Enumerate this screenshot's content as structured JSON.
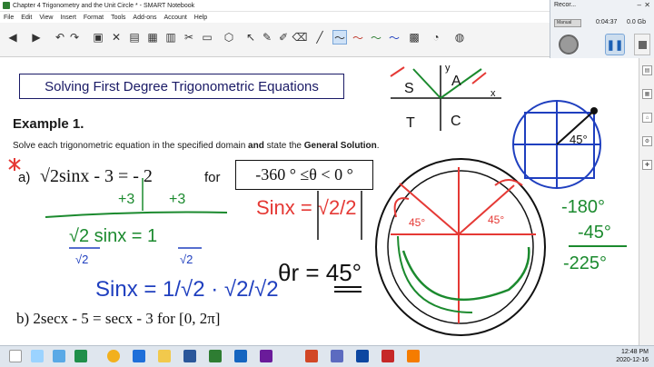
{
  "window": {
    "title": "Chapter 4 Trigonometry and the Unit Circle * - SMART Notebook"
  },
  "menu": [
    "File",
    "Edit",
    "View",
    "Insert",
    "Format",
    "Tools",
    "Add-ons",
    "Account",
    "Help"
  ],
  "toolbar": {
    "page_zoom_label": "Recor...",
    "icons": [
      "back-icon",
      "forward-icon",
      "add-page-icon",
      "delete-page-icon",
      "undo-icon",
      "redo-icon",
      "select-icon",
      "pen-icon",
      "eraser-icon",
      "line-icon",
      "shape-icon",
      "fill-icon",
      "text-icon",
      "table-icon",
      "camera-icon",
      "screen-shade-icon"
    ]
  },
  "recorder": {
    "title": "Recor...",
    "mode_label": "Manual",
    "elapsed": "0:04:37",
    "size": "0.0 Gb"
  },
  "lesson": {
    "title": "Solving First Degree Trigonometric Equations",
    "example_heading": "Example 1.",
    "instructions_prefix": "Solve each trigonometric equation in the specified domain ",
    "instructions_and": "and",
    "instructions_mid": " state the ",
    "instructions_bold": "General Solution",
    "instructions_end": ".",
    "part_a_label": "a)",
    "part_a_equation": "√2sinx - 3 =  - 2",
    "part_a_for": "for",
    "part_a_domain": "-360 ° ≤θ < 0 °",
    "part_b": "b) 2secx - 5 = secx - 3  for  [0, 2π]"
  },
  "handwriting": {
    "plus_three_left": "+3",
    "plus_three_right": "+3",
    "root2_sinx": "√2 sinx = 1",
    "denom_left": "√2",
    "denom_right": "√2",
    "sinx_result": "Sinx = 1/√2 · √2/√2",
    "sinx_boxed": "Sinx = √2/2",
    "ref_angle": "θr = 45°",
    "quad_s": "S",
    "quad_a": "A",
    "quad_t": "T",
    "quad_c": "C",
    "axis_y": "y",
    "axis_x": "x",
    "circle_angle": "45°",
    "arc_angle_left": "45°",
    "arc_angle_right": "45°",
    "calc_line1": "-180°",
    "calc_line2": "-45°",
    "calc_line3": "-225°"
  },
  "taskbar": {
    "time": "12:48 PM",
    "date": "2020-12-16"
  },
  "colors": {
    "accent_red": "#e53935",
    "ink_green": "#1b8a2e",
    "ink_blue": "#1f3fbf",
    "ink_black": "#111111",
    "title_border": "#1a1a66"
  }
}
